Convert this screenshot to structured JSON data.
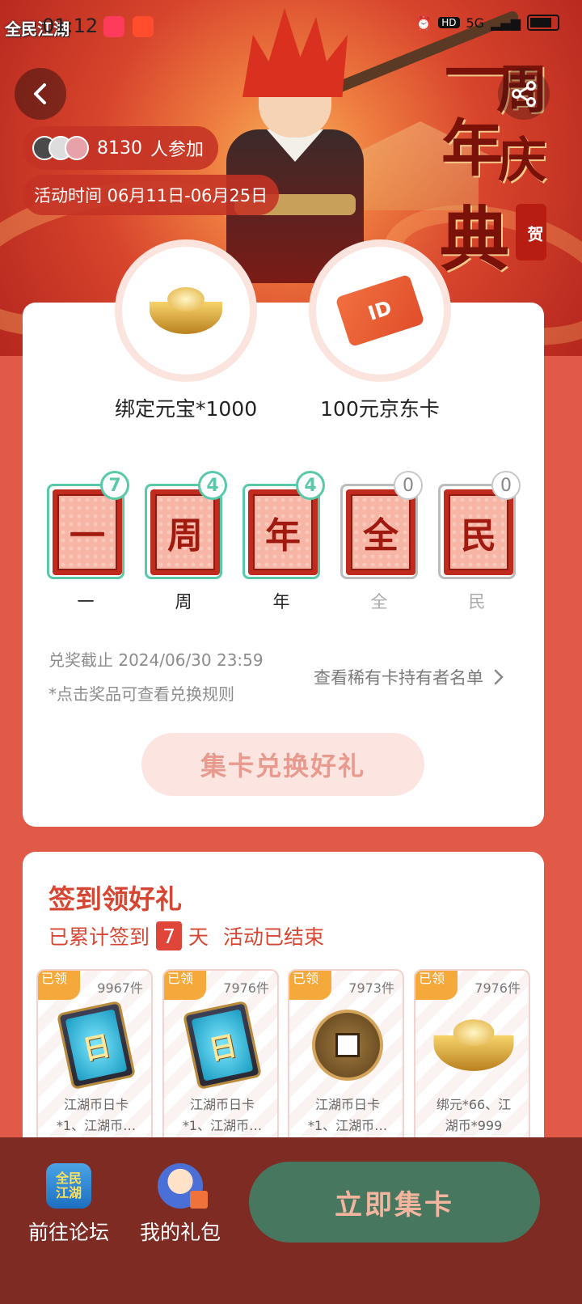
{
  "status_bar": {
    "time": "01:12",
    "hd": "HD",
    "net": "5G"
  },
  "hero": {
    "logo_text": "全民江湖",
    "title_chars": [
      "一",
      "周",
      "年",
      "庆",
      "典"
    ],
    "stamp": "贺",
    "participants_count": "8130",
    "participants_suffix": "人参加",
    "period": "活动时间 06月11日-06月25日"
  },
  "prizes": [
    {
      "label": "绑定元宝*1000",
      "icon": "gold-ingot-icon"
    },
    {
      "label": "100元京东卡",
      "icon": "jd-card-icon",
      "card_text": "ID"
    }
  ],
  "collect_cards": [
    {
      "char": "一",
      "name": "一",
      "count": "7",
      "owned": true
    },
    {
      "char": "周",
      "name": "周",
      "count": "4",
      "owned": true
    },
    {
      "char": "年",
      "name": "年",
      "count": "4",
      "owned": true
    },
    {
      "char": "全",
      "name": "全",
      "count": "0",
      "owned": false
    },
    {
      "char": "民",
      "name": "民",
      "count": "0",
      "owned": false
    }
  ],
  "exchange": {
    "deadline": "兑奖截止 2024/06/30 23:59",
    "rule_note": "*点击奖品可查看兑换规则",
    "holders_link": "查看稀有卡持有者名单",
    "button": "集卡兑换好礼"
  },
  "signin": {
    "title": "签到领好礼",
    "status_prefix": "已累计签到",
    "days": "7",
    "status_unit": "天",
    "ended": "活动已结束",
    "gifts": [
      {
        "tag": "已领",
        "stock": "9967件",
        "desc1": "江湖币日卡",
        "desc2": "*1、江湖币…",
        "icon": "day-card-icon",
        "glyph": "日"
      },
      {
        "tag": "已领",
        "stock": "7976件",
        "desc1": "江湖币日卡",
        "desc2": "*1、江湖币…",
        "icon": "day-card-icon",
        "glyph": "日"
      },
      {
        "tag": "已领",
        "stock": "7973件",
        "desc1": "江湖币日卡",
        "desc2": "*1、江湖币…",
        "icon": "coin-icon"
      },
      {
        "tag": "已领",
        "stock": "7976件",
        "desc1": "绑元*66、江",
        "desc2": "湖币*999",
        "icon": "gold-ingot-icon"
      }
    ]
  },
  "bottom_bar": {
    "forum_label": "前往论坛",
    "forum_icon_text": "全民江湖",
    "gifts_label": "我的礼包",
    "collect_button": "立即集卡"
  },
  "colors": {
    "accent": "#e05a47",
    "badge_teal": "#59c9a9",
    "bottom_bar": "#7d2b23",
    "collect_button": "#47775f"
  }
}
